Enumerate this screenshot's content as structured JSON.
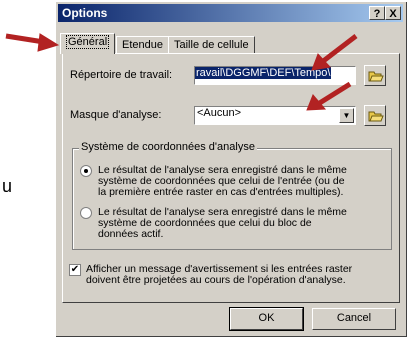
{
  "side_text": "u",
  "dialog": {
    "title": "Options",
    "help_button": "?",
    "close_button": "X",
    "tabs": [
      {
        "label": "Général"
      },
      {
        "label": "Etendue"
      },
      {
        "label": "Taille de cellule"
      }
    ],
    "workspace": {
      "label": "Répertoire de travail:",
      "value": "ravail\\DGGMF\\DEF\\Tempo\\"
    },
    "mask": {
      "label": "Masque d'analyse:",
      "value": "<Aucun>"
    },
    "coord_group": {
      "label": "Système de coordonnées d'analyse",
      "option1": {
        "line1": "Le résultat de l'analyse sera enregistré dans le même",
        "line2": "système de coordonnées que celui de l'entrée (ou de",
        "line3": "la première entrée raster en cas d'entrées multiples).",
        "selected": true
      },
      "option2": {
        "line1": "Le résultat de l'analyse sera enregistré dans le même",
        "line2": "système de coordonnées que celui du bloc de",
        "line3": "données actif.",
        "selected": false
      }
    },
    "warning": {
      "line1": "Afficher un message d'avertissement si les entrées raster",
      "line2": "doivent être projetées au cours de l'opération d'analyse.",
      "checked": true
    },
    "ok_label": "OK",
    "cancel_label": "Cancel"
  },
  "colors": {
    "annotation_arrow": "#b22222",
    "titlebar": "#0a246a"
  }
}
